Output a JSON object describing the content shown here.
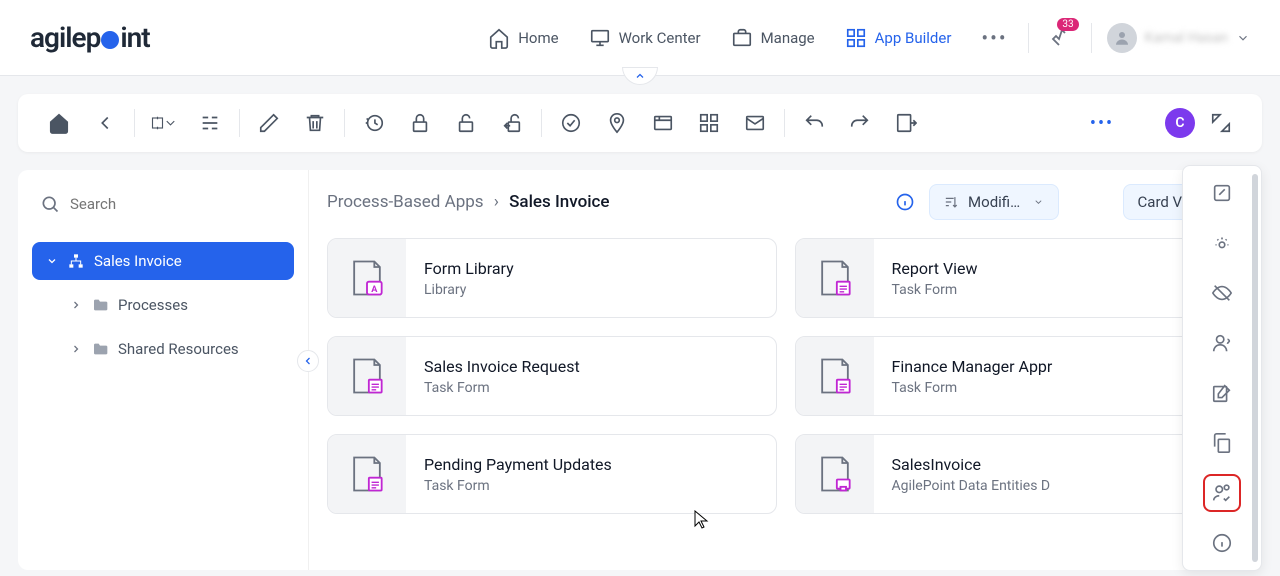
{
  "header": {
    "logo_agile": "agilep",
    "logo_int": "int",
    "nav": {
      "home": "Home",
      "workcenter": "Work Center",
      "manage": "Manage",
      "appbuilder": "App Builder"
    },
    "notif_count": "33",
    "username": "Kamal Hasan"
  },
  "sidebar": {
    "search_placeholder": "Search",
    "root": {
      "label": "Sales Invoice"
    },
    "children": [
      {
        "label": "Processes"
      },
      {
        "label": "Shared Resources"
      }
    ]
  },
  "content": {
    "breadcrumb_parent": "Process-Based Apps",
    "breadcrumb_sep": "›",
    "breadcrumb_current": "Sales Invoice",
    "sort_label": "Modifie…",
    "view_label": "Card View",
    "cards": [
      {
        "title": "Form Library",
        "subtitle": "Library",
        "icon": "library"
      },
      {
        "title": "Report View",
        "subtitle": "Task Form",
        "icon": "form"
      },
      {
        "title": "Sales Invoice Request",
        "subtitle": "Task Form",
        "icon": "form"
      },
      {
        "title": "Finance Manager Appr",
        "subtitle": "Task Form",
        "icon": "form"
      },
      {
        "title": "Pending Payment Updates",
        "subtitle": "Task Form",
        "icon": "form"
      },
      {
        "title": "SalesInvoice",
        "subtitle": "AgilePoint Data Entities D",
        "icon": "entity"
      }
    ]
  },
  "toolbar_purple": "C"
}
